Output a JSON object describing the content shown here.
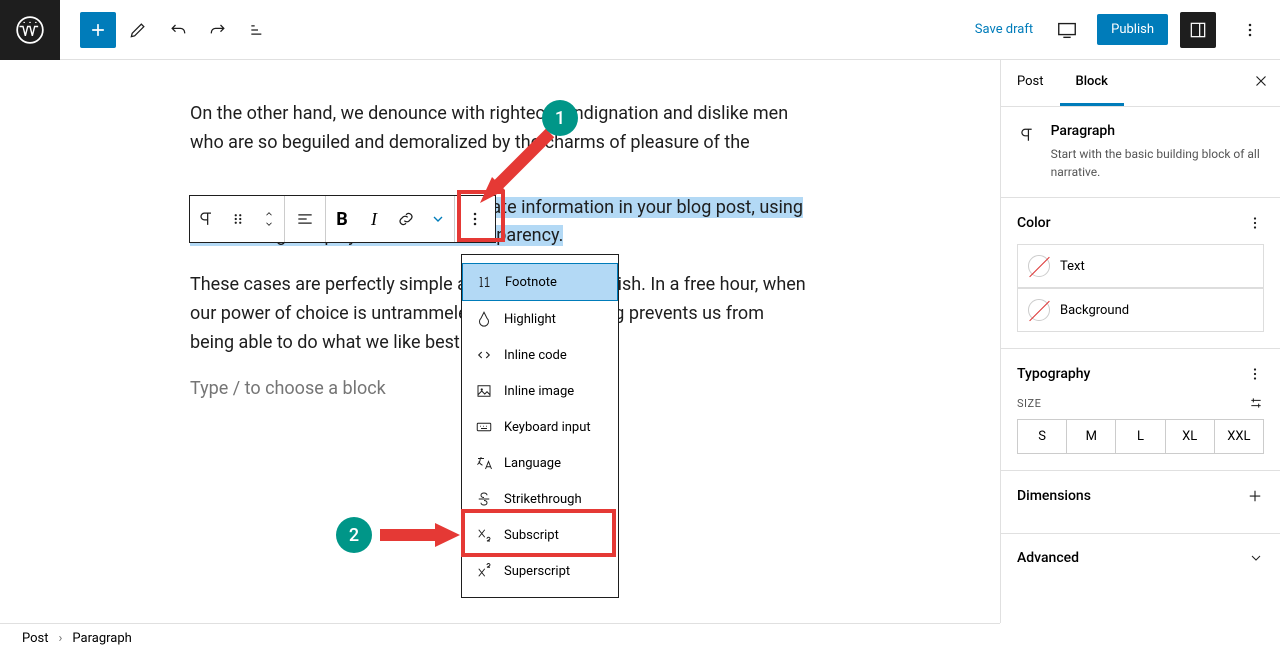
{
  "topbar": {
    "save_draft": "Save draft",
    "publish": "Publish"
  },
  "content": {
    "para1": "On the other hand, we denounce with righteous indignation and dislike men who are so beguiled and demoralized by the charms of pleasure of the",
    "para2": "If you've made an error or need to update information in your blog post, using strikethrough helps you maintain transparency.",
    "para3": "These cases are perfectly simple and easy to distinguish. In a free hour, when our power of choice is untrammeled and when nothing prevents us from being able to do what we like best.",
    "placeholder": "Type / to choose a block"
  },
  "dropdown": {
    "items": [
      {
        "label": "Footnote"
      },
      {
        "label": "Highlight"
      },
      {
        "label": "Inline code"
      },
      {
        "label": "Inline image"
      },
      {
        "label": "Keyboard input"
      },
      {
        "label": "Language"
      },
      {
        "label": "Strikethrough"
      },
      {
        "label": "Subscript"
      },
      {
        "label": "Superscript"
      }
    ]
  },
  "sidebar": {
    "tabs": {
      "post": "Post",
      "block": "Block"
    },
    "block": {
      "title": "Paragraph",
      "desc": "Start with the basic building block of all narrative."
    },
    "color": {
      "heading": "Color",
      "text": "Text",
      "background": "Background"
    },
    "typography": {
      "heading": "Typography",
      "size_label": "SIZE",
      "sizes": [
        "S",
        "M",
        "L",
        "XL",
        "XXL"
      ]
    },
    "dimensions": "Dimensions",
    "advanced": "Advanced"
  },
  "breadcrumb": {
    "post": "Post",
    "paragraph": "Paragraph"
  },
  "annotations": {
    "one": "1",
    "two": "2"
  }
}
